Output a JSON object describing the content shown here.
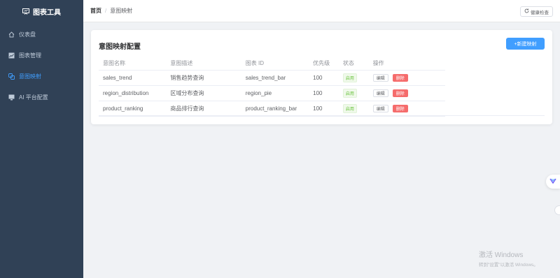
{
  "sidebar": {
    "brand": "图表工具",
    "items": [
      {
        "label": "仪表盘",
        "icon": "home-icon"
      },
      {
        "label": "图表管理",
        "icon": "chart-icon"
      },
      {
        "label": "意图映射",
        "icon": "link-icon",
        "active": true
      },
      {
        "label": "AI 平台配置",
        "icon": "monitor-icon"
      }
    ]
  },
  "breadcrumb": {
    "home": "首页",
    "separator": "/",
    "current": "意图映射"
  },
  "header": {
    "health_button": "健康检查"
  },
  "main": {
    "title": "意图映射配置",
    "new_button": "+新建映射",
    "columns": [
      "意图名称",
      "意图描述",
      "图表 ID",
      "优先级",
      "状态",
      "操作"
    ],
    "rows": [
      {
        "name": "sales_trend",
        "desc": "销售趋势查询",
        "chart_id": "sales_trend_bar",
        "priority": "100",
        "status": "启用",
        "edit": "编辑",
        "delete": "删除"
      },
      {
        "name": "region_distribution",
        "desc": "区域分布查询",
        "chart_id": "region_pie",
        "priority": "100",
        "status": "启用",
        "edit": "编辑",
        "delete": "删除"
      },
      {
        "name": "product_ranking",
        "desc": "商品排行查询",
        "chart_id": "product_ranking_bar",
        "priority": "100",
        "status": "启用",
        "edit": "编辑",
        "delete": "删除"
      }
    ]
  },
  "watermark": {
    "line1": "激活 Windows",
    "line2": "转到\"设置\"以激活 Windows。"
  },
  "colors": {
    "sidebar_bg": "#304156",
    "accent": "#409eff",
    "danger": "#f56c6c",
    "success": "#67c23a"
  }
}
